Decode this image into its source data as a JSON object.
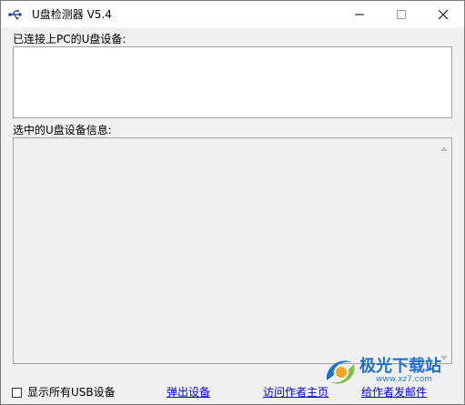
{
  "window": {
    "title": "U盘检测器 V5.4",
    "app_icon": "usb-icon"
  },
  "titlebar_buttons": {
    "minimize_icon": "minimize-icon",
    "maximize_icon": "maximize-icon",
    "close_icon": "close-icon"
  },
  "main": {
    "connected_label": "已连接上PC的U盘设备:",
    "connected_devices": [],
    "selected_info_label": "选中的U盘设备信息:",
    "selected_info": ""
  },
  "footer": {
    "show_all_usb_label": "显示所有USB设备",
    "show_all_usb_checked": false,
    "eject_link": "弹出设备",
    "visit_author_link": "访问作者主页",
    "mail_author_link": "给作者发邮件"
  },
  "watermark": {
    "brand": "极光下载站",
    "url": "www.xz7.com"
  },
  "colors": {
    "link": "#0000ee",
    "window_bg": "#f0f0f0",
    "title_bg": "#ffffff",
    "watermark": "#1f6fd1"
  }
}
